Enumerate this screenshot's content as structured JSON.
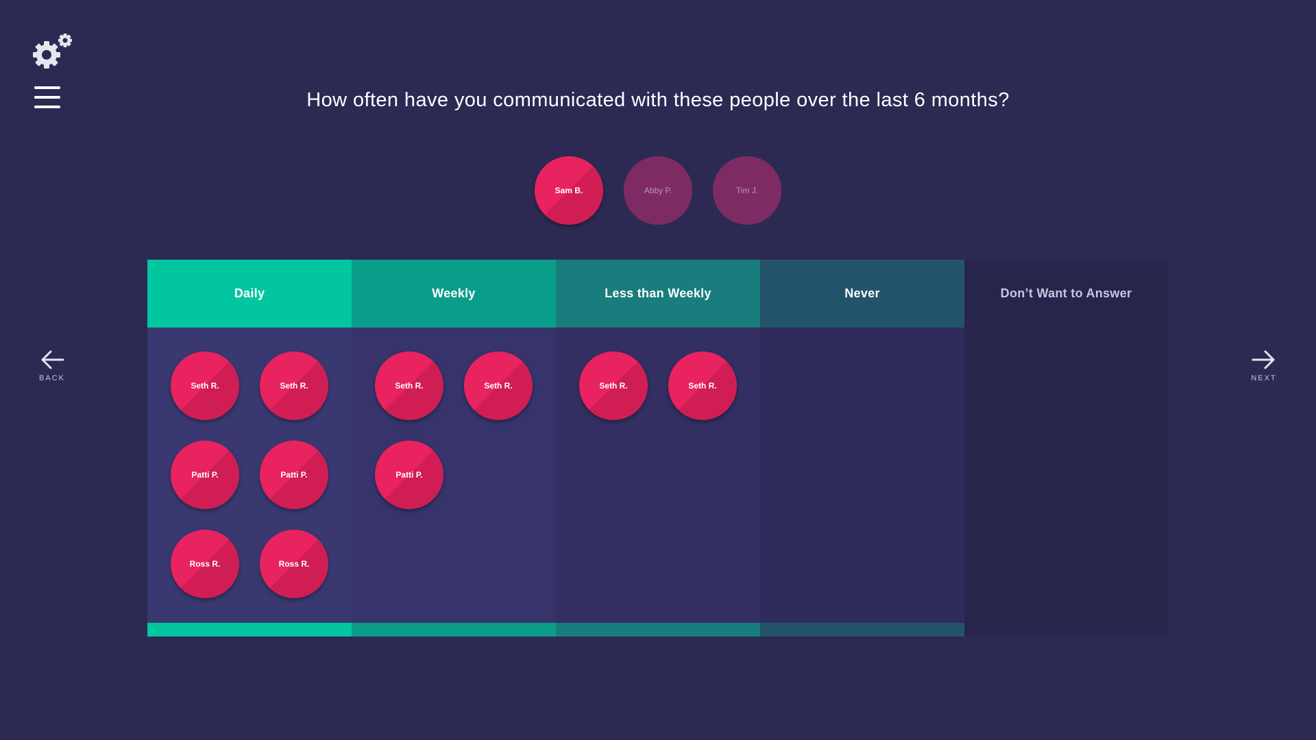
{
  "question": "How often have you communicated with these people over the last 6 months?",
  "pending_people": [
    {
      "name": "Sam B.",
      "state": "active"
    },
    {
      "name": "Abby P.",
      "state": "dim"
    },
    {
      "name": "Tim J.",
      "state": "dim"
    }
  ],
  "columns": [
    {
      "label": "Daily",
      "people": [
        "Seth R.",
        "Seth R.",
        "Patti P.",
        "Patti P.",
        "Ross R.",
        "Ross R."
      ]
    },
    {
      "label": "Weekly",
      "people": [
        "Seth R.",
        "Seth R.",
        "Patti P."
      ]
    },
    {
      "label": "Less than Weekly",
      "people": [
        "Seth R.",
        "Seth R."
      ]
    },
    {
      "label": "Never",
      "people": []
    },
    {
      "label": "Don’t Want to Answer",
      "people": []
    }
  ],
  "nav": {
    "back_label": "BACK",
    "next_label": "NEXT"
  },
  "icons": {
    "settings": "gears-icon",
    "menu": "hamburger-menu-icon",
    "back": "arrow-left-icon",
    "next": "arrow-right-icon"
  },
  "colors": {
    "background": "#2c2a53",
    "token": "#e8235f",
    "token_dim": "#7e2b64",
    "daily": "#02c6a0",
    "weekly": "#0a9d8a",
    "less_than_weekly": "#187d7c",
    "never": "#23536a",
    "dont_want": "#28254d"
  }
}
